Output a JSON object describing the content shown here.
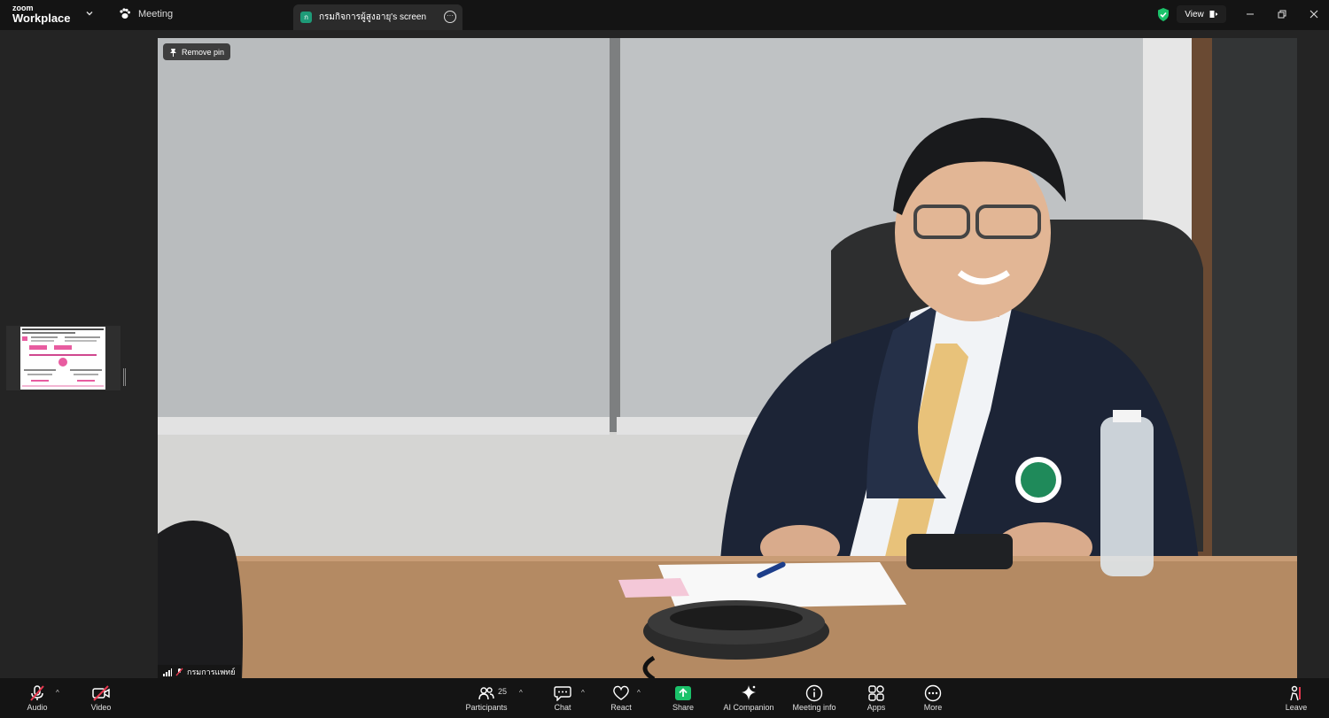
{
  "titlebar": {
    "logo_top": "zoom",
    "logo_bottom": "Workplace",
    "meeting_tab": "Meeting",
    "screen_tab": "กรมกิจการผู้สูงอายุ's screen",
    "screen_tab_badge": "ก",
    "view_label": "View"
  },
  "video": {
    "remove_pin_label": "Remove pin",
    "participant_name": "กรมการแพทย์"
  },
  "toolbar": {
    "audio": "Audio",
    "video": "Video",
    "participants": "Participants",
    "participants_count": "25",
    "chat": "Chat",
    "react": "React",
    "share": "Share",
    "ai_companion": "AI Companion",
    "meeting_info": "Meeting info",
    "apps": "Apps",
    "more": "More",
    "leave": "Leave"
  },
  "colors": {
    "share_green": "#1bc26a",
    "mute_red": "#e8384f",
    "shield_green": "#1bc26a"
  }
}
